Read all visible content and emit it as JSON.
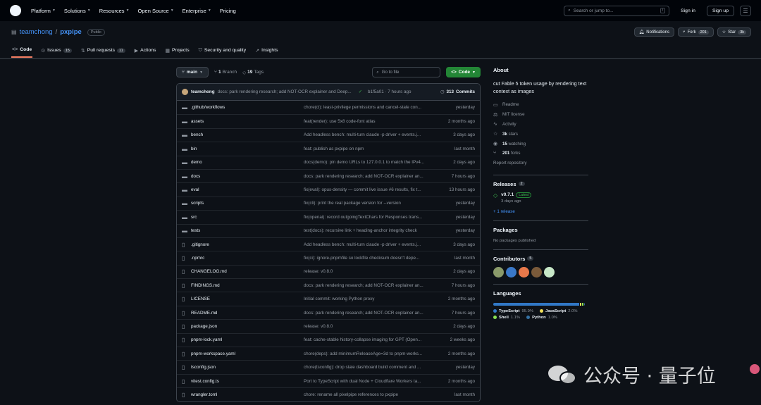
{
  "topnav": {
    "items": [
      "Platform",
      "Solutions",
      "Resources",
      "Open Source",
      "Enterprise",
      "Pricing"
    ],
    "search_placeholder": "Search or jump to...",
    "search_key": "/",
    "sign_in": "Sign in",
    "sign_up": "Sign up"
  },
  "repo": {
    "owner": "teamchong",
    "separator": "/",
    "name": "pxpipe",
    "visibility": "Public",
    "notifications": "Notifications",
    "fork_label": "Fork",
    "fork_count": "201",
    "star_label": "Star",
    "star_count": "3k"
  },
  "tabs": [
    {
      "label": "Code",
      "icon": "code-icon",
      "count": ""
    },
    {
      "label": "Issues",
      "icon": "issue-icon",
      "count": "15"
    },
    {
      "label": "Pull requests",
      "icon": "pull-request-icon",
      "count": "11"
    },
    {
      "label": "Actions",
      "icon": "actions-icon",
      "count": ""
    },
    {
      "label": "Projects",
      "icon": "projects-icon",
      "count": ""
    },
    {
      "label": "Security and quality",
      "icon": "shield-icon",
      "count": ""
    },
    {
      "label": "Insights",
      "icon": "graph-icon",
      "count": ""
    }
  ],
  "branchbar": {
    "branch": "main",
    "branch_count": "1",
    "branch_word": "Branch",
    "tag_count": "19",
    "tag_word": "Tags",
    "goto_placeholder": "Go to file",
    "code_button": "Code"
  },
  "commit": {
    "author": "teamchong",
    "message": "docs: park rendering research; add NOT-OCR explainer and Deep...",
    "sha_time": "b1f5a01 · 7 hours ago",
    "count": "313",
    "count_word": "Commits"
  },
  "files": [
    {
      "name": ".github/workflows",
      "type": "dir",
      "message": "chore(ci): least-privilege permissions and cancel-stale con...",
      "date": "yesterday"
    },
    {
      "name": "assets",
      "type": "dir",
      "message": "feat(render): use 5x8 code-font atlas",
      "date": "2 months ago"
    },
    {
      "name": "bench",
      "type": "dir",
      "message": "Add headless bench: multi-turn claude -p driver + events.j...",
      "date": "3 days ago"
    },
    {
      "name": "bin",
      "type": "dir",
      "message": "feat: publish as pxpipe on npm",
      "date": "last month"
    },
    {
      "name": "demo",
      "type": "dir",
      "message": "docs(demo): pin demo URLs to 127.0.0.1 to match the IPv4...",
      "date": "2 days ago"
    },
    {
      "name": "docs",
      "type": "dir",
      "message": "docs: park rendering research; add NOT-OCR explainer an...",
      "date": "7 hours ago"
    },
    {
      "name": "eval",
      "type": "dir",
      "message": "fix(eval): opus-density — commit live issue #6 results, fix t...",
      "date": "13 hours ago"
    },
    {
      "name": "scripts",
      "type": "dir",
      "message": "fix(cli): print the real package version for --version",
      "date": "yesterday"
    },
    {
      "name": "src",
      "type": "dir",
      "message": "fix(openai): record outgoingTextChars for Responses trans...",
      "date": "yesterday"
    },
    {
      "name": "tests",
      "type": "dir",
      "message": "test(docs): recursive link + heading-anchor integrity check",
      "date": "yesterday"
    },
    {
      "name": ".gitignore",
      "type": "file",
      "message": "Add headless bench: multi-turn claude -p driver + events.j...",
      "date": "3 days ago"
    },
    {
      "name": ".npmrc",
      "type": "file",
      "message": "fix(ci): ignore-pnpmfile so lockfile checksum doesn't depe...",
      "date": "last month"
    },
    {
      "name": "CHANGELOG.md",
      "type": "file",
      "message": "release: v0.8.0",
      "date": "2 days ago"
    },
    {
      "name": "FINDINGS.md",
      "type": "file",
      "message": "docs: park rendering research; add NOT-OCR explainer an...",
      "date": "7 hours ago"
    },
    {
      "name": "LICENSE",
      "type": "file",
      "message": "Initial commit: working Python proxy",
      "date": "2 months ago"
    },
    {
      "name": "README.md",
      "type": "file",
      "message": "docs: park rendering research; add NOT-OCR explainer an...",
      "date": "7 hours ago"
    },
    {
      "name": "package.json",
      "type": "file",
      "message": "release: v0.8.0",
      "date": "2 days ago"
    },
    {
      "name": "pnpm-lock.yaml",
      "type": "file",
      "message": "feat: cache-stable history-collapse imaging for GPT (Open...",
      "date": "2 weeks ago"
    },
    {
      "name": "pnpm-workspace.yaml",
      "type": "file",
      "message": "chore(deps): add minimumReleaseAge=3d to pnpm-works...",
      "date": "2 months ago"
    },
    {
      "name": "tsconfig.json",
      "type": "file",
      "message": "chore(tsconfig): drop stale dashboard build comment and ...",
      "date": "yesterday"
    },
    {
      "name": "vitest.config.ts",
      "type": "file",
      "message": "Port to TypeScript with dual Node + Cloudflare Workers ta...",
      "date": "2 months ago"
    },
    {
      "name": "wrangler.toml",
      "type": "file",
      "message": "chore: rename all pixelpipe references to pxpipe",
      "date": "last month"
    }
  ],
  "about": {
    "heading": "About",
    "description": "cut Fable 5 token usage by rendering text context as images",
    "items": [
      {
        "icon": "book-icon",
        "label": "Readme",
        "bold": ""
      },
      {
        "icon": "scale-icon",
        "label": "MIT license",
        "bold": ""
      },
      {
        "icon": "pulse-icon",
        "label": "Activity",
        "bold": ""
      },
      {
        "icon": "star-icon",
        "label": " stars",
        "bold": "3k"
      },
      {
        "icon": "eye-icon",
        "label": " watching",
        "bold": "15"
      },
      {
        "icon": "fork-icon",
        "label": " forks",
        "bold": "201"
      }
    ],
    "report": "Report repository"
  },
  "releases": {
    "heading": "Releases",
    "count": "2",
    "tag": "v0.7.1",
    "latest": "Latest",
    "date": "3 days ago",
    "more": "+ 1 release"
  },
  "packages": {
    "heading": "Packages",
    "empty": "No packages published"
  },
  "contributors": {
    "heading": "Contributors",
    "count": "5",
    "colors": [
      "#8a9a6a",
      "#3a78c8",
      "#e8784a",
      "#7a5a3a",
      "#c8e8c8"
    ]
  },
  "languages": {
    "heading": "Languages",
    "list": [
      {
        "name": "TypeScript",
        "percent": "95.9%",
        "color": "#3178c6",
        "share": 95.9
      },
      {
        "name": "JavaScript",
        "percent": "2.0%",
        "color": "#f1e05a",
        "share": 2.0
      },
      {
        "name": "Shell",
        "percent": "1.1%",
        "color": "#89e051",
        "share": 1.1
      },
      {
        "name": "Python",
        "percent": "1.0%",
        "color": "#3572a5",
        "share": 1.0
      }
    ]
  },
  "watermark": {
    "text": "公众号 · 量子位"
  }
}
